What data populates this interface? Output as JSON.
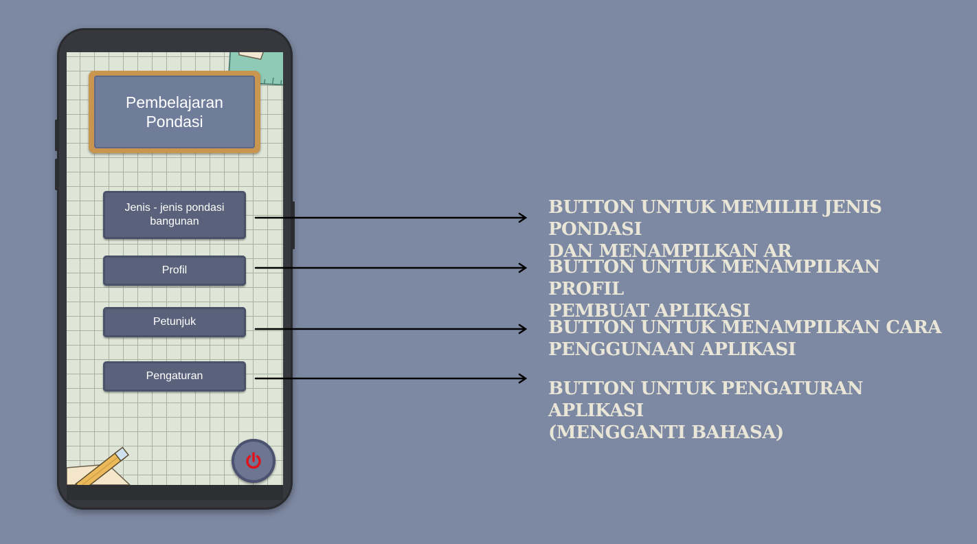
{
  "app": {
    "title": "Pembelajaran Pondasi"
  },
  "menu": {
    "jenis_label": "Jenis - jenis pondasi bangunan",
    "profil_label": "Profil",
    "petunjuk_label": "Petunjuk",
    "pengaturan_label": "Pengaturan"
  },
  "power_button": {
    "icon": "power-icon",
    "color": "#e0121b"
  },
  "annotations": [
    {
      "line1": "BUTTON UNTUK MEMILIH JENIS PONDASI",
      "line2": "DAN MENAMPILKAN AR"
    },
    {
      "line1": "BUTTON UNTUK MENAMPILKAN PROFIL",
      "line2": "PEMBUAT APLIKASI"
    },
    {
      "line1": "BUTTON UNTUK MENAMPILKAN CARA",
      "line2": "PENGGUNAAN APLIKASI"
    },
    {
      "line1": "BUTTON UNTUK PENGATURAN APLIKASI",
      "line2": "(MENGGANTI BAHASA)"
    }
  ],
  "colors": {
    "background": "#7d89a2",
    "annotation_text": "#e9e6d8",
    "button": "#59627a",
    "title_frame": "#c9964f"
  }
}
